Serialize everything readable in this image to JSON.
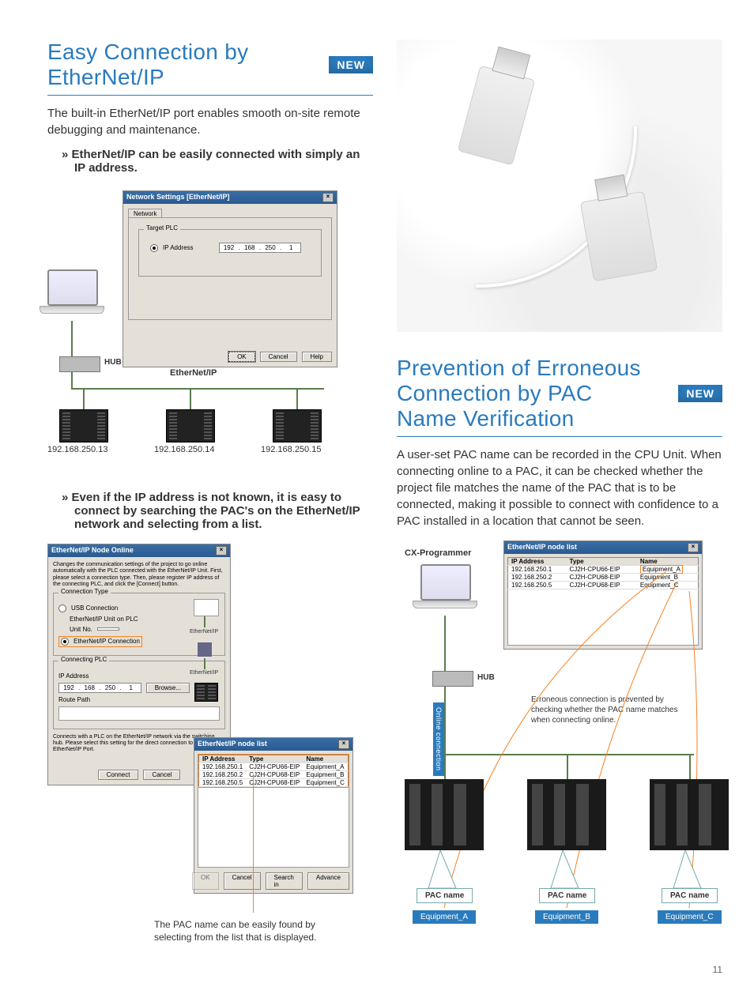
{
  "left": {
    "title": "Easy Connection by EtherNet/IP",
    "new_badge": "NEW",
    "intro": "The built-in EtherNet/IP port enables smooth on-site remote debugging and maintenance.",
    "bullet1": "EtherNet/IP can be easily connected with simply an IP address.",
    "dialog1": {
      "title": "Network Settings [EtherNet/IP]",
      "tab": "Network",
      "group": "Target PLC",
      "ip_label": "IP Address",
      "ip": [
        "192",
        "168",
        "250",
        "1"
      ],
      "ok": "OK",
      "cancel": "Cancel",
      "help": "Help"
    },
    "hub": "HUB",
    "net_label": "EtherNet/IP",
    "ips": [
      "192.168.250.13",
      "192.168.250.14",
      "192.168.250.15"
    ],
    "bullet2": "Even if the IP address is not known, it is easy to connect by searching the PAC's on the EtherNet/IP network and selecting from a list.",
    "dialog2": {
      "title": "EtherNet/IP Node Online",
      "desc": "Changes the communication settings of the project to go online automatically with the PLC connected with the EtherNet/IP Unit. First, please select a connection type. Then, please register IP address of the connecting PLC, and click the [Connect] button.",
      "conn_type_group": "Connection Type",
      "usb_radio": "USB Connection",
      "eip_on_plc": "EtherNet/IP Unit on PLC",
      "unit_no": "Unit No.",
      "eip_radio": "EtherNet/IP Connection",
      "conn_plc_group": "Connecting PLC",
      "ip_label": "IP Address",
      "ip": [
        "192",
        "168",
        "250",
        "1"
      ],
      "browse": "Browse...",
      "route": "Route Path",
      "hint": "Connects with a PLC on the EtherNet/IP network via the switching hub. Please select this setting for the direct connection to Built-in EtherNet/IP Port.",
      "connect": "Connect",
      "cancel": "Cancel",
      "net1": "EtherNet/IP",
      "net2": "EtherNet/IP"
    },
    "nodelist": {
      "title": "EtherNet/IP node list",
      "cols": [
        "IP Address",
        "Type",
        "Name"
      ],
      "rows": [
        [
          "192.168.250.1",
          "CJ2H-CPU66-EIP",
          "Equipment_A"
        ],
        [
          "192.168.250.2",
          "CJ2H-CPU68-EIP",
          "Equipment_B"
        ],
        [
          "192.168.250.5",
          "CJ2H-CPU68-EIP",
          "Equipment_C"
        ]
      ],
      "ok": "OK",
      "cancel": "Cancel",
      "search": "Search in",
      "advance": "Advance"
    },
    "caption2": "The PAC name can be easily found by selecting from the list that is displayed."
  },
  "right": {
    "title": "Prevention of Erroneous Connection by PAC Name Verification",
    "new_badge": "NEW",
    "body": "A user-set PAC name can be recorded in the CPU Unit. When connecting online to a PAC, it can be checked whether the project file matches the name of the PAC that is to be connected, making it possible to connect with confidence to a PAC installed in a location that cannot be seen.",
    "cxp_label": "CX-Programmer",
    "nodelist": {
      "title": "EtherNet/IP node list",
      "cols": [
        "IP Address",
        "Type",
        "Name"
      ],
      "rows": [
        [
          "192.168.250.1",
          "CJ2H-CPU66-EIP",
          "Equipment_A"
        ],
        [
          "192.168.250.2",
          "CJ2H-CPU68-EIP",
          "Equipment_B"
        ],
        [
          "192.168.250.5",
          "CJ2H-CPU68-EIP",
          "Equipment_C"
        ]
      ]
    },
    "hub": "HUB",
    "online_conn": "Online connection",
    "callout": "Erroneous connection is prevented by checking whether the PAC name matches when connecting online.",
    "pac_label": "PAC name",
    "equips": [
      "Equipment_A",
      "Equipment_B",
      "Equipment_C"
    ]
  },
  "page_number": "11"
}
